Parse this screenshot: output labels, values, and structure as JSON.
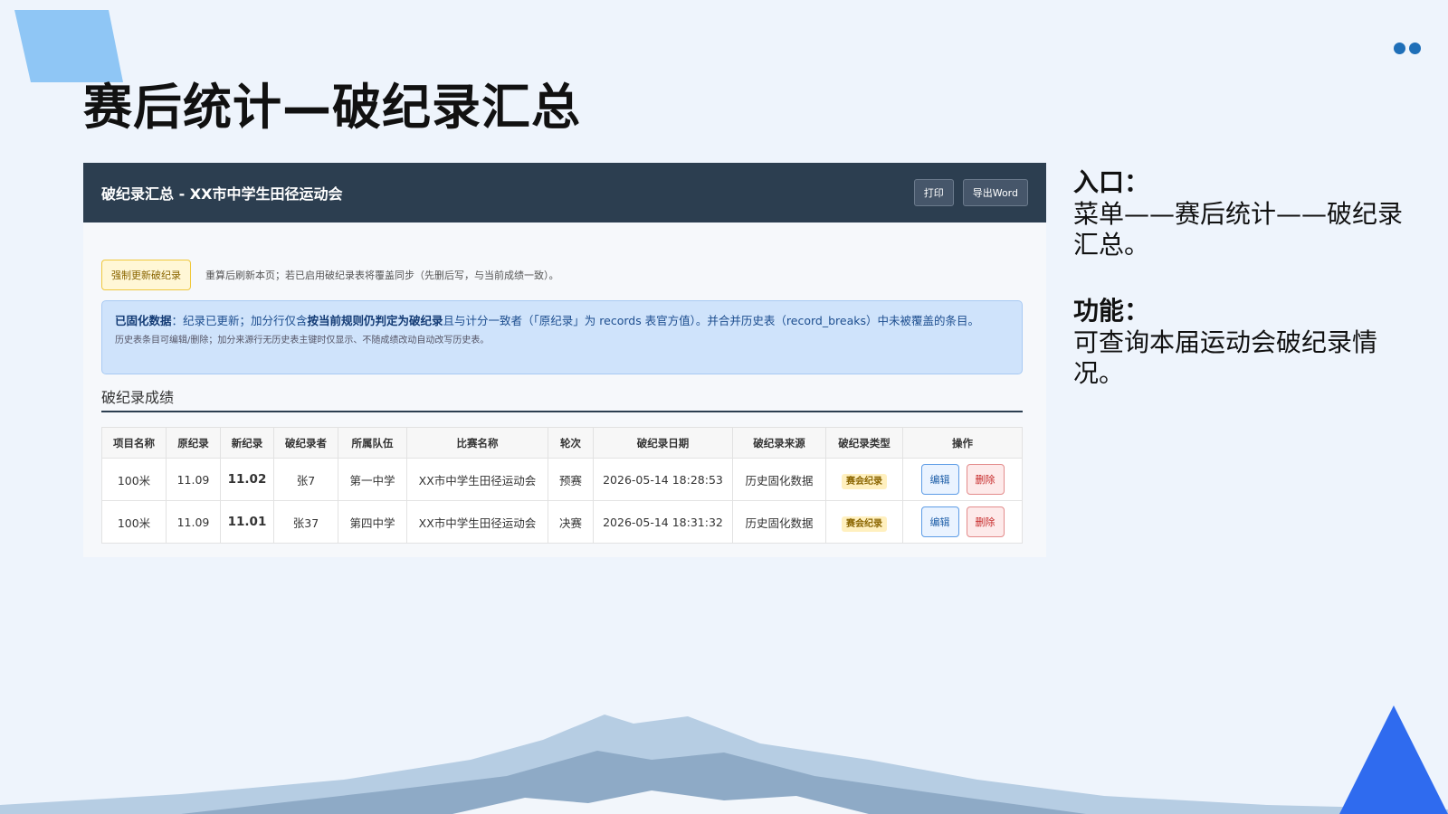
{
  "slide": {
    "title": "赛后统计—破纪录汇总"
  },
  "panel": {
    "title": "破纪录汇总 - XX市中学生田径运动会",
    "print_label": "打印",
    "export_label": "导出Word",
    "force_label": "强制更新破纪录",
    "force_note": "重算后刷新本页；若已启用破纪录表将覆盖同步（先删后写，与当前成绩一致）。",
    "info": {
      "bold1": "已固化数据",
      "text1": "：纪录已更新；加分行仅含",
      "bold2": "按当前规则仍判定为破纪录",
      "text2": "且与计分一致者（「原纪录」为 records 表官方值）。并合并历史表（record_breaks）中未被覆盖的条目。",
      "line2": "历史表条目可编辑/删除；加分来源行无历史表主键时仅显示、不随成绩改动自动改写历史表。"
    },
    "section_title": "破纪录成绩",
    "table": {
      "headers": [
        "项目名称",
        "原纪录",
        "新纪录",
        "破纪录者",
        "所属队伍",
        "比赛名称",
        "轮次",
        "破纪录日期",
        "破纪录来源",
        "破纪录类型",
        "操作"
      ],
      "rows": [
        {
          "event": "100米",
          "old": "11.09",
          "new": "11.02",
          "athlete": "张7",
          "team": "第一中学",
          "competition": "XX市中学生田径运动会",
          "round": "预赛",
          "date": "2026-05-14 18:28:53",
          "source": "历史固化数据",
          "type": "赛会纪录",
          "edit": "编辑",
          "delete": "删除"
        },
        {
          "event": "100米",
          "old": "11.09",
          "new": "11.01",
          "athlete": "张37",
          "team": "第四中学",
          "competition": "XX市中学生田径运动会",
          "round": "决赛",
          "date": "2026-05-14 18:31:32",
          "source": "历史固化数据",
          "type": "赛会纪录",
          "edit": "编辑",
          "delete": "删除"
        }
      ]
    }
  },
  "side": {
    "entry_heading": "入口：",
    "entry_text": "菜单——赛后统计——破纪录汇总。",
    "func_heading": "功能：",
    "func_text": "可查询本届运动会破纪录情况。"
  },
  "colors": {
    "background": "#eef4fc",
    "header": "#2c3e50",
    "new_record": "#d32f2f",
    "accent_triangle": "#2f6bef"
  }
}
